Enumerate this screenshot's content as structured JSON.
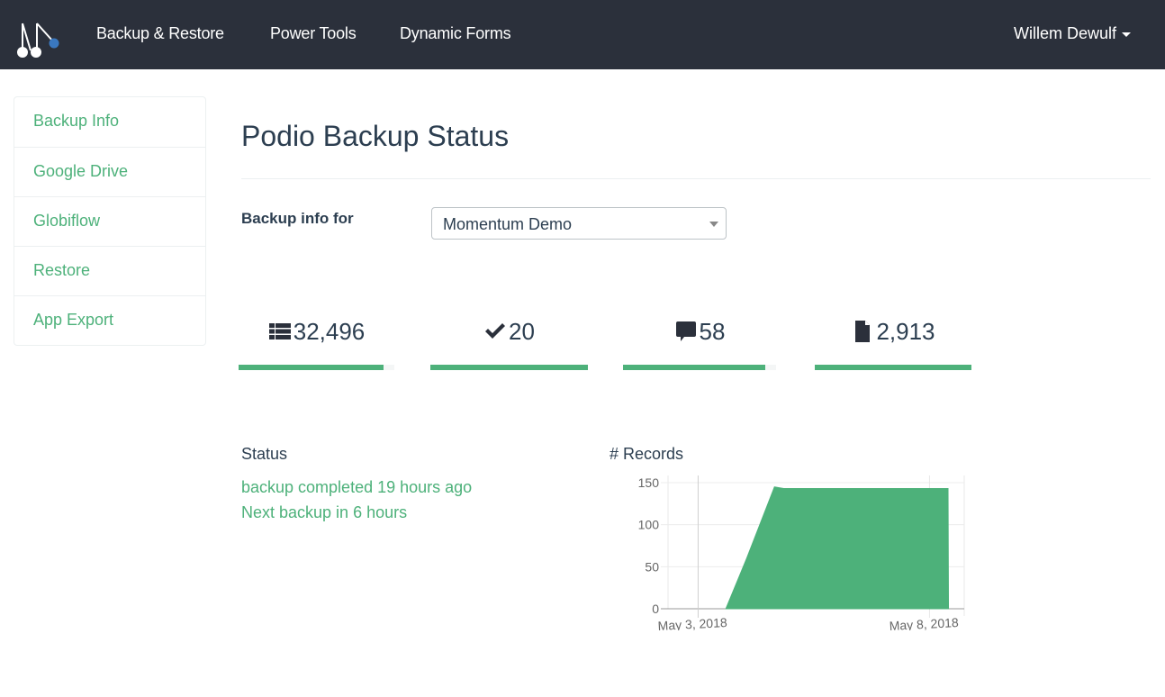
{
  "navbar": {
    "brand_icon": "pendulum-logo-icon",
    "links": [
      {
        "label": "Backup & Restore"
      },
      {
        "label": "Power Tools"
      },
      {
        "label": "Dynamic Forms"
      }
    ],
    "user": {
      "name": "Willem Dewulf",
      "icon": "caret-down-icon"
    }
  },
  "sidebar": {
    "items": [
      {
        "label": "Backup Info"
      },
      {
        "label": "Google Drive"
      },
      {
        "label": "Globiflow"
      },
      {
        "label": "Restore"
      },
      {
        "label": "App Export"
      }
    ]
  },
  "main": {
    "title": "Podio Backup Status",
    "backup_for_label": "Backup info for",
    "select": {
      "value": "Momentum Demo"
    },
    "stats": [
      {
        "icon": "list-icon",
        "value": "32,496",
        "progress": 0.93
      },
      {
        "icon": "check-icon",
        "value": "20",
        "progress": 1.0
      },
      {
        "icon": "comment-icon",
        "value": "58",
        "progress": 0.93
      },
      {
        "icon": "file-icon",
        "value": "2,913",
        "progress": 1.0
      }
    ],
    "status": {
      "label": "Status",
      "lines": [
        "backup completed 19 hours ago",
        "Next backup in 6 hours"
      ]
    },
    "chart_title": "# Records"
  },
  "colors": {
    "accent": "#4db17a",
    "navbar": "#2b303b",
    "text": "#2c3e50"
  },
  "chart_data": {
    "type": "area",
    "title": "# Records",
    "xlabel": "",
    "ylabel": "",
    "x_tick_labels": [
      "May 3, 2018",
      "May 8, 2018"
    ],
    "x_ticks_days": [
      0,
      5
    ],
    "xlim_days": [
      -0.65,
      5.75
    ],
    "ylim": [
      0,
      150
    ],
    "y_ticks": [
      0,
      50,
      100,
      150
    ],
    "grid": true,
    "legend": "none",
    "series": [
      {
        "name": "# Records",
        "color": "#4db17a",
        "x_days": [
          0.6,
          1.05,
          1.65,
          1.75,
          1.85,
          2.5,
          3.5,
          4.5,
          5.4,
          5.41
        ],
        "values": [
          0,
          60,
          145,
          144,
          143,
          143,
          143,
          143,
          143,
          0
        ]
      }
    ]
  }
}
